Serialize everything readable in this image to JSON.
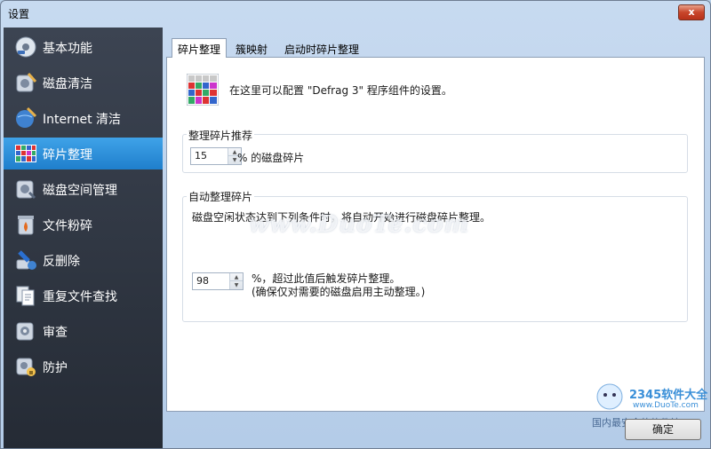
{
  "window": {
    "title": "设置",
    "close_label": "x"
  },
  "sidebar": {
    "items": [
      {
        "label": "基本功能",
        "icon": "settings-disc-icon"
      },
      {
        "label": "磁盘清洁",
        "icon": "disk-clean-icon"
      },
      {
        "label": "Internet 清洁",
        "icon": "internet-clean-icon"
      },
      {
        "label": "碎片整理",
        "icon": "defrag-grid-icon",
        "active": true
      },
      {
        "label": "磁盘空间管理",
        "icon": "disk-space-icon"
      },
      {
        "label": "文件粉碎",
        "icon": "shredder-icon"
      },
      {
        "label": "反删除",
        "icon": "undelete-icon"
      },
      {
        "label": "重复文件查找",
        "icon": "duplicate-files-icon"
      },
      {
        "label": "审查",
        "icon": "audit-icon"
      },
      {
        "label": "防护",
        "icon": "protection-icon"
      }
    ]
  },
  "tabs": [
    {
      "label": "碎片整理",
      "active": true
    },
    {
      "label": "簇映射"
    },
    {
      "label": "启动时碎片整理"
    }
  ],
  "intro": {
    "text": "在这里可以配置 \"Defrag 3\" 程序组件的设置。"
  },
  "recommend_group": {
    "title": "整理碎片推荐",
    "value": "15",
    "suffix": "% 的磁盘碎片"
  },
  "auto_group": {
    "title": "自动整理碎片",
    "description": "磁盘空闲状态达到下列条件时，将自动开始进行磁盘碎片整理。",
    "value": "98",
    "suffix_line1": "%，超过此值后触发碎片整理。",
    "suffix_line2": "(确保仅对需要的磁盘启用主动整理。)"
  },
  "ok_label": "确定",
  "watermark": "www.DuoTe.com",
  "corner": {
    "brand": "2345软件大全",
    "url": "www.DuoTe.com",
    "slogan": "国内最安全的软件站"
  },
  "colors": {
    "accent": "#2a8ad8",
    "sidebar_bg": "#2e3440"
  }
}
